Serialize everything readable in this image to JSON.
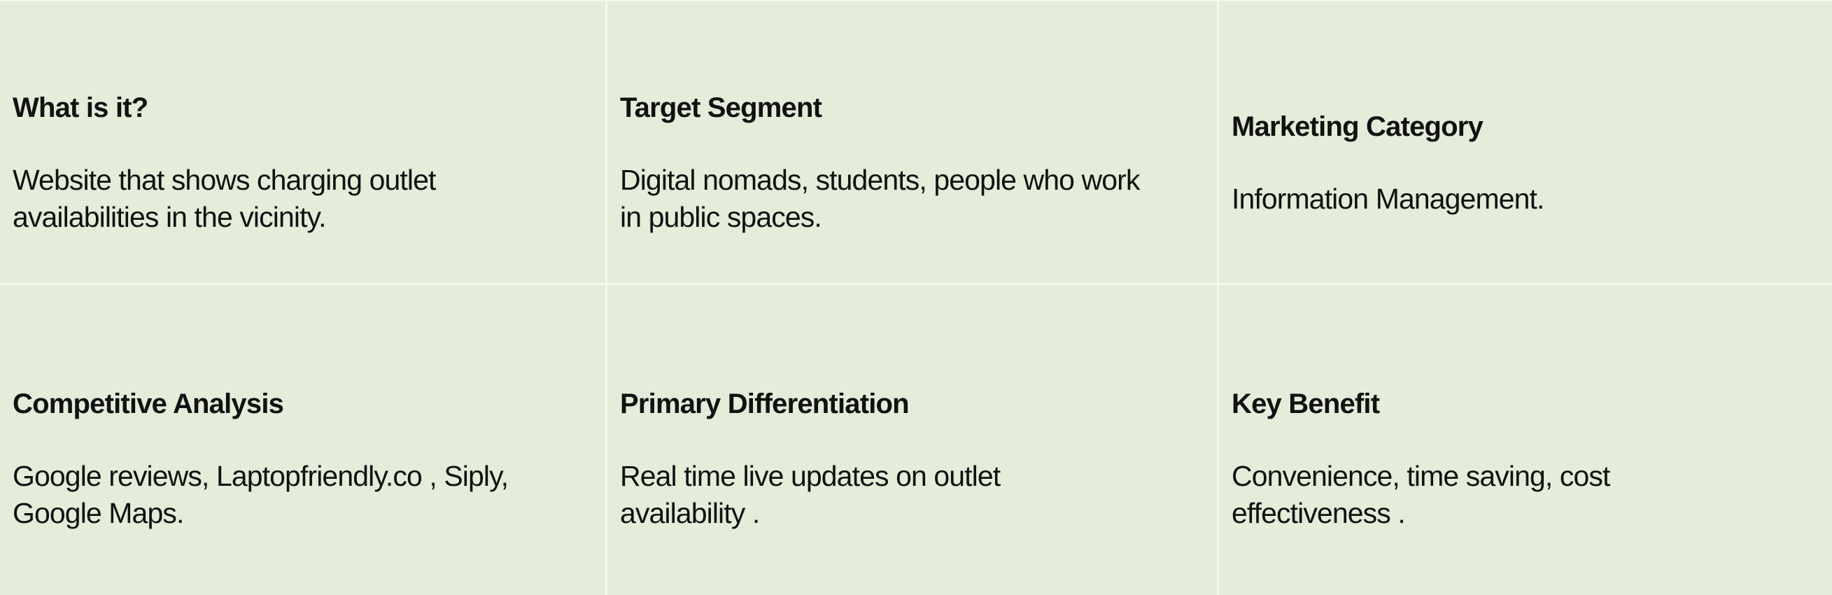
{
  "cells": [
    {
      "heading": "What is it?",
      "body": "Website that shows charging outlet availabilities in the vicinity."
    },
    {
      "heading": "Target Segment",
      "body": "Digital nomads, students, people who work in public spaces."
    },
    {
      "heading": "Marketing Category",
      "body": "Information Management."
    },
    {
      "heading": "Competitive Analysis",
      "body": "Google reviews, Laptopfriendly.co , Siply, Google Maps."
    },
    {
      "heading": "Primary Differentiation",
      "body": "Real time live updates on outlet availability ."
    },
    {
      "heading": "Key Benefit",
      "body": "Convenience, time saving, cost effectiveness ."
    }
  ]
}
